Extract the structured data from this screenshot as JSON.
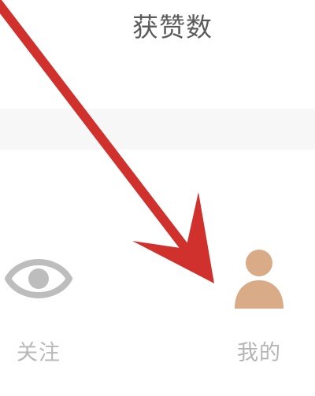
{
  "stats": {
    "likes_label": "获赞数"
  },
  "tabbar": {
    "tabs": [
      {
        "label": "关注",
        "icon": "eye-icon",
        "active": false
      },
      {
        "label": "我的",
        "icon": "person-icon",
        "active": true
      }
    ]
  },
  "colors": {
    "arrow": "#d0312d",
    "active_icon": "#d9ab87",
    "inactive_icon": "#bdbdbd",
    "tab_label": "#b8b8b8"
  }
}
